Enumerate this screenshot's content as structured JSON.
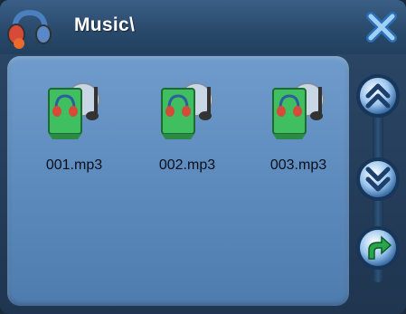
{
  "window": {
    "title": "Music\\"
  },
  "titlebar": {
    "app_icon": "headphones-icon",
    "close_icon": "close-icon"
  },
  "files": [
    {
      "name": "001.mp3",
      "icon": "audio-file-icon"
    },
    {
      "name": "002.mp3",
      "icon": "audio-file-icon"
    },
    {
      "name": "003.mp3",
      "icon": "audio-file-icon"
    }
  ],
  "sidebar": {
    "scroll_up_icon": "double-chevron-up-icon",
    "scroll_down_icon": "double-chevron-down-icon",
    "back_icon": "return-arrow-icon"
  },
  "colors": {
    "panel": "#5d8bbd",
    "titlebar": "#2a4a6c",
    "accent_green": "#3fbf5f",
    "close_blue": "#6fb4ec"
  }
}
